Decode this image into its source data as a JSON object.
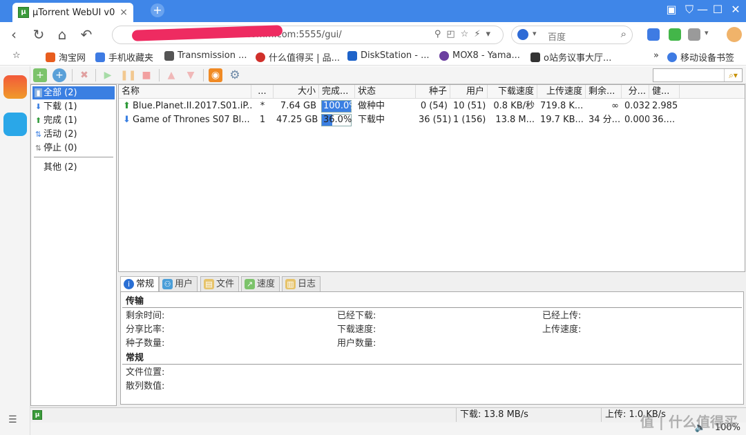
{
  "browser": {
    "tab_title": "µTorrent WebUI v0",
    "tab_favicon": "µ",
    "url": "a...e0...0de017ccf4f.asuscomm.com:5555/gui/",
    "search_placeholder": "百度",
    "zoom": "100%",
    "bookmarks": [
      {
        "label": "淘宝网",
        "color": "#e85d1e"
      },
      {
        "label": "手机收藏夹",
        "color": "#3e7be3"
      },
      {
        "label": "Transmission ...",
        "color": "#555555"
      },
      {
        "label": "什么值得买 | 品...",
        "color": "#d0302b"
      },
      {
        "label": "DiskStation - ...",
        "color": "#1e63c9"
      },
      {
        "label": "MOX8 - Yama...",
        "color": "#6b3fa0"
      },
      {
        "label": "o站务议事大厅...",
        "color": "#333333"
      }
    ],
    "mobile_bookmarks": "移动设备书签"
  },
  "categories": [
    {
      "label": "全部 (2)",
      "icon": "all-icon"
    },
    {
      "label": "下载 (1)",
      "icon": "download-arrow-icon"
    },
    {
      "label": "完成 (1)",
      "icon": "upload-arrow-icon"
    },
    {
      "label": "活动 (2)",
      "icon": "active-icon"
    },
    {
      "label": "停止 (0)",
      "icon": "stopped-icon"
    },
    {
      "label": "其他 (2)",
      "icon": ""
    }
  ],
  "columns": [
    "名称",
    "...",
    "大小",
    "完成...",
    "状态",
    "种子",
    "用户",
    "下载速度",
    "上传速度",
    "剩余...",
    "分...",
    "健..."
  ],
  "torrents": [
    {
      "name": "Blue.Planet.II.2017.S01.iP...",
      "queue": "*",
      "size": "7.64 GB",
      "progress": 100.0,
      "progress_label": "100.0%",
      "status": "做种中",
      "seeds": "0 (54)",
      "peers": "10 (51)",
      "down_speed": "0.8 KB/秒",
      "up_speed": "719.8 K...",
      "eta": "∞",
      "ratio": "0.032",
      "health": "2.985",
      "direction": "up"
    },
    {
      "name": "Game of Thrones S07 Bl...",
      "queue": "1",
      "size": "47.25 GB",
      "progress": 36.0,
      "progress_label": "36.0%",
      "status": "下载中",
      "seeds": "36 (51)",
      "peers": "1 (156)",
      "down_speed": "13.8 M...",
      "up_speed": "19.7 KB...",
      "eta": "34 分...",
      "ratio": "0.000",
      "health": "36....",
      "direction": "down"
    }
  ],
  "detail_tabs": [
    "常规",
    "用户",
    "文件",
    "速度",
    "日志"
  ],
  "details": {
    "transfer_header": "传输",
    "general_header": "常规",
    "remaining_time": "剩余时间:",
    "downloaded": "已经下载:",
    "uploaded": "已经上传:",
    "share_ratio": "分享比率:",
    "down_speed": "下载速度:",
    "up_speed": "上传速度:",
    "seeds": "种子数量:",
    "peers": "用户数量:",
    "save_path": "文件位置:",
    "hash": "散列数值:"
  },
  "status": {
    "download": "下载: 13.8 MB/s",
    "upload": "上传: 1.0 KB/s"
  },
  "watermark": "值 | 什么值得买"
}
